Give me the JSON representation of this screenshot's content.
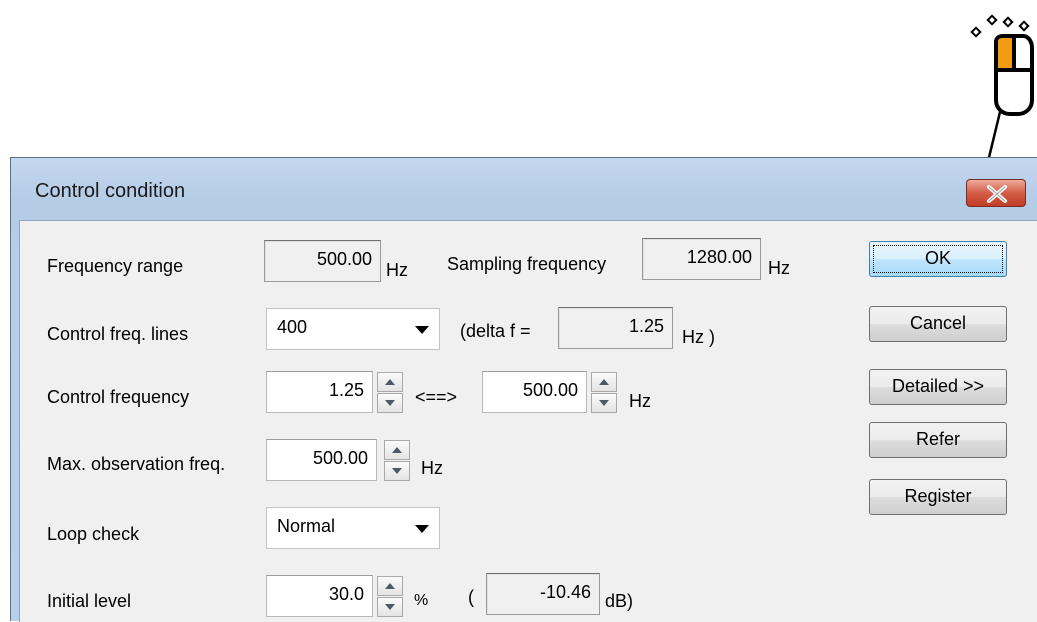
{
  "window": {
    "title": "Control condition"
  },
  "rows": {
    "frequency_range": {
      "label": "Frequency range",
      "value": "500.00",
      "unit": "Hz"
    },
    "sampling_frequency": {
      "label": "Sampling frequency",
      "value": "1280.00",
      "unit": "Hz"
    },
    "control_freq_lines": {
      "label": "Control freq. lines",
      "selected": "400",
      "delta_prefix": "(delta f =",
      "delta_value": "1.25",
      "delta_suffix": "Hz )"
    },
    "control_frequency": {
      "label": "Control frequency",
      "low": "1.25",
      "separator": "<==>",
      "high": "500.00",
      "unit": "Hz"
    },
    "max_observation_freq": {
      "label": "Max. observation freq.",
      "value": "500.00",
      "unit": "Hz"
    },
    "loop_check": {
      "label": "Loop check",
      "selected": "Normal"
    },
    "initial_level": {
      "label": "Initial level",
      "value": "30.0",
      "unit": "%",
      "db_prefix": "(",
      "db_value": "-10.46",
      "db_suffix": "dB)"
    }
  },
  "buttons": {
    "ok": "OK",
    "cancel": "Cancel",
    "detailed": "Detailed >>",
    "refer": "Refer",
    "register": "Register"
  },
  "icons": {
    "mouse": "mouse-left-click-icon",
    "close": "close-icon",
    "spin": "spin-up-down-icon",
    "dropdown": "chevron-down-icon"
  },
  "colors": {
    "title_bar": "#b9d0ea",
    "close_button": "#c8452d",
    "ok_button": "#bee6fd",
    "mouse_highlight": "#f39c12"
  }
}
